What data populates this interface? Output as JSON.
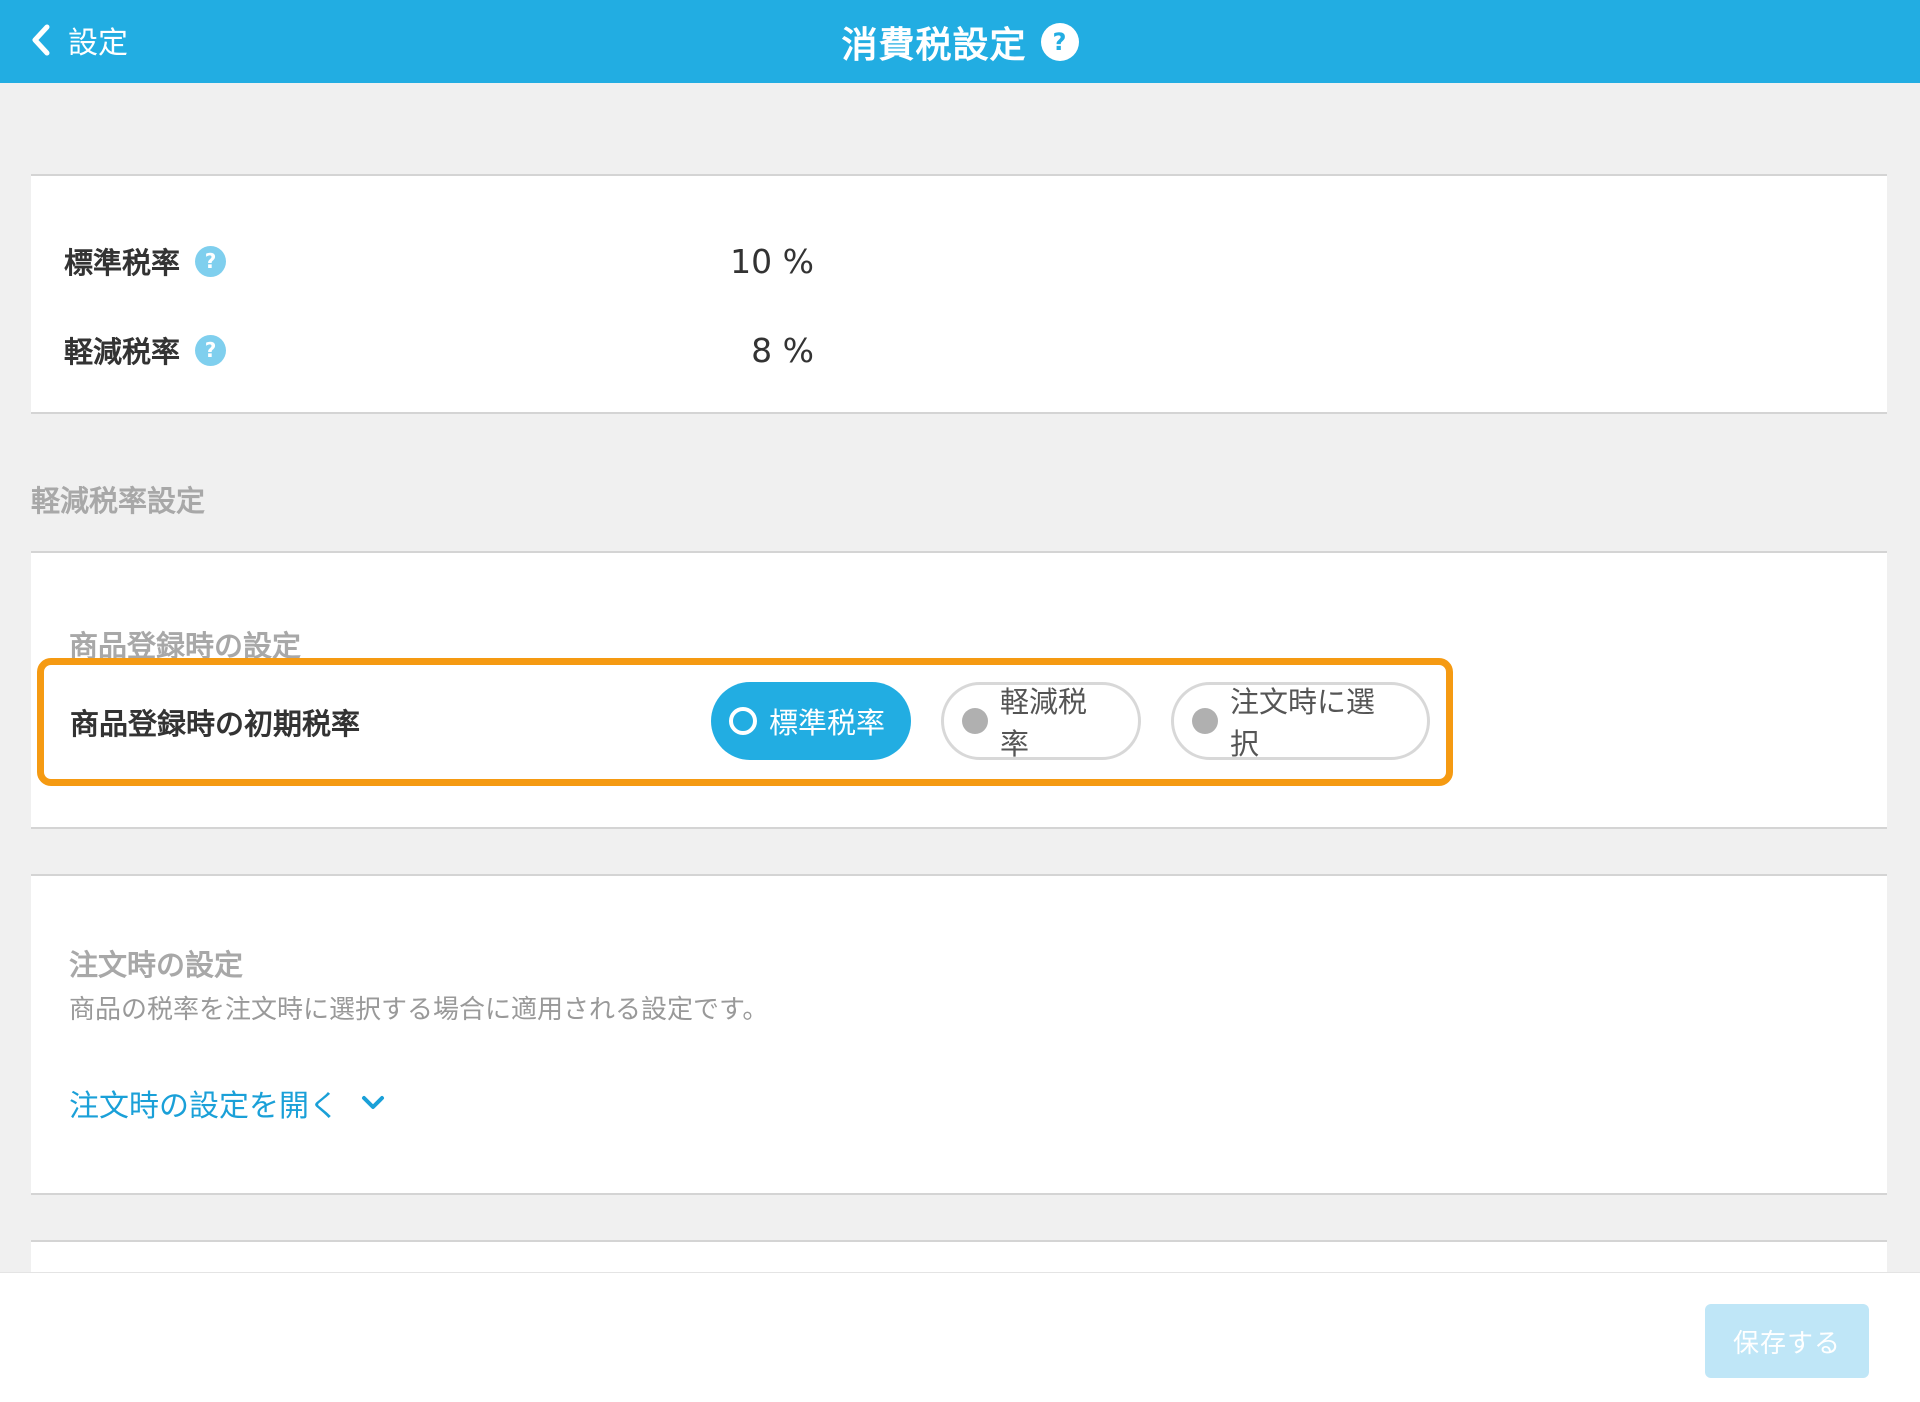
{
  "header": {
    "back_label": "設定",
    "title": "消費税設定",
    "help_glyph": "?"
  },
  "rates": {
    "standard_label": "標準税率",
    "standard_value": "10 %",
    "reduced_label": "軽減税率",
    "reduced_value": "8 %",
    "help_glyph": "?"
  },
  "reduced_section": {
    "heading": "軽減税率設定",
    "product_registration": {
      "title": "商品登録時の設定",
      "row_label": "商品登録時の初期税率",
      "options": [
        {
          "label": "標準税率",
          "selected": true
        },
        {
          "label": "軽減税率",
          "selected": false
        },
        {
          "label": "注文時に選択",
          "selected": false
        }
      ]
    },
    "order": {
      "title": "注文時の設定",
      "description": "商品の税率を注文時に選択する場合に適用される設定です。",
      "open_link": "注文時の設定を開く"
    }
  },
  "footer": {
    "save_label": "保存する"
  },
  "colors": {
    "header": "#22ade2",
    "highlight": "#f59a12",
    "selected_pill": "#22ade2",
    "link": "#1aa0d8",
    "save_disabled": "#bfe6f7"
  },
  "icons": {
    "back": "chevron-left-icon",
    "help": "question-circle-icon",
    "expand": "chevron-down-icon"
  }
}
